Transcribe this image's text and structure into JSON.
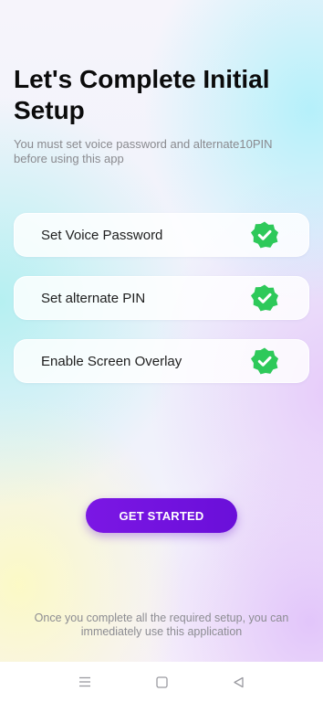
{
  "header": {
    "title": "Let's Complete Initial Setup",
    "subtitle": "You must set voice password and alternate10PIN before using this app"
  },
  "setup_items": [
    {
      "label": "Set Voice Password",
      "status_icon": "check-badge-icon",
      "completed": true
    },
    {
      "label": "Set alternate PIN",
      "status_icon": "check-badge-icon",
      "completed": true
    },
    {
      "label": "Enable Screen Overlay",
      "status_icon": "check-badge-icon",
      "completed": true
    }
  ],
  "cta": {
    "label": "GET STARTED"
  },
  "footer": {
    "note": "Once you complete all the required setup, you can immediately use this application"
  },
  "navbar": {
    "icons": [
      "menu-icon",
      "home-square-icon",
      "back-triangle-icon"
    ]
  },
  "colors": {
    "accent": "#7012de",
    "check_badge": "#2ec95a",
    "title_text": "#0b0b0b",
    "muted_text": "#8a8a8f"
  }
}
